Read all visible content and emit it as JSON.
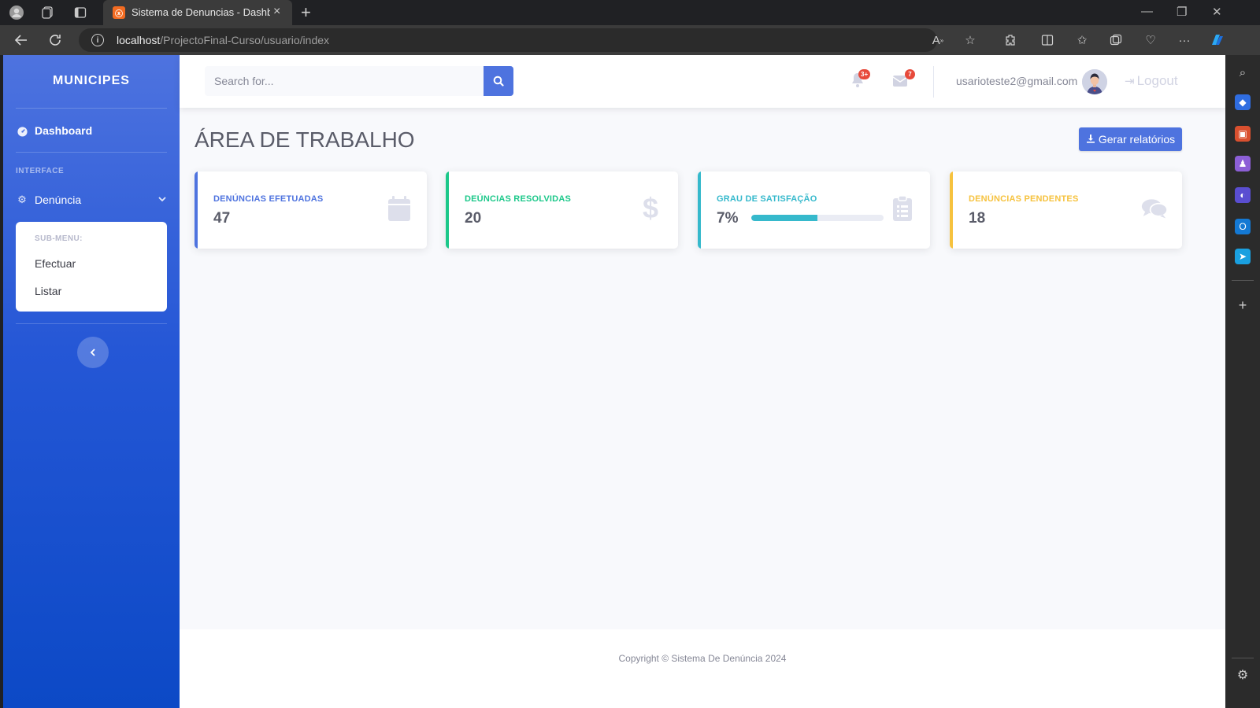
{
  "browser": {
    "tab_title": "Sistema de Denuncias - Dashboard",
    "url_host": "localhost",
    "url_path": "/ProjectoFinal-Curso/usuario/index"
  },
  "sidebar": {
    "brand": "MUNICIPES",
    "dashboard_label": "Dashboard",
    "section_heading": "INTERFACE",
    "menu_label": "Denúncia",
    "submenu": {
      "heading": "SUB-MENU:",
      "items": [
        {
          "label": "Efectuar"
        },
        {
          "label": "Listar"
        }
      ]
    }
  },
  "topbar": {
    "search_placeholder": "Search for...",
    "alerts_badge": "3+",
    "messages_badge": "7",
    "user_email": "usarioteste2@gmail.com",
    "logout_label": "Logout"
  },
  "main": {
    "heading": "ÁREA DE TRABALHO",
    "report_button": "Gerar relatórios",
    "cards": [
      {
        "label": "DENÚNCIAS EFETUADAS",
        "value": "47",
        "color": "#4e73df",
        "icon": "calendar-icon"
      },
      {
        "label": "DEÚNCIAS RESOLVIDAS",
        "value": "20",
        "color": "#1cc88a",
        "icon": "dollar-icon"
      },
      {
        "label": "GRAU DE SATISFAÇÃO",
        "value": "7%",
        "color": "#36b9cc",
        "icon": "clipboard-list-icon",
        "progress": 0.5
      },
      {
        "label": "DENÚNCIAS PENDENTES",
        "value": "18",
        "color": "#f6c23e",
        "icon": "comments-icon"
      }
    ]
  },
  "footer": {
    "copyright": "Copyright © Sistema De Denúncia 2024"
  },
  "colors": {
    "primary": "#4e73df",
    "success": "#1cc88a",
    "info": "#36b9cc",
    "warning": "#f6c23e",
    "danger": "#e74a3b"
  }
}
